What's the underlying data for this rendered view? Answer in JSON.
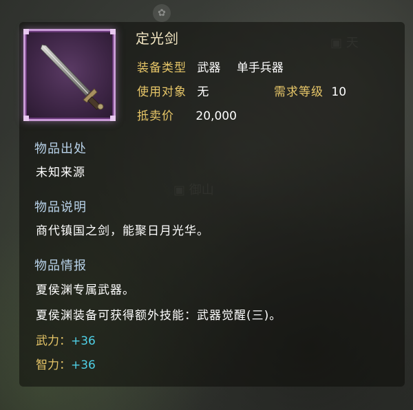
{
  "item": {
    "name": "定光剑",
    "icon": "sword-icon",
    "frame_color": "#c99bd6"
  },
  "attributes": {
    "equip_type_label": "装备类型",
    "equip_type_value": "武器",
    "weapon_class": "单手兵器",
    "user_label": "使用对象",
    "user_value": "无",
    "level_label": "需求等级",
    "level_value": "10",
    "price_label": "抵卖价",
    "price_value": "20,000"
  },
  "origin": {
    "heading": "物品出处",
    "text": "未知来源"
  },
  "description": {
    "heading": "物品说明",
    "text": "商代镇国之剑，能聚日月光华。"
  },
  "info": {
    "heading": "物品情报",
    "lines": [
      "夏侯渊专属武器。",
      "夏侯渊装备可获得额外技能：武器觉醒(三)。"
    ]
  },
  "stats": [
    {
      "label": "武力：",
      "value": "+36"
    },
    {
      "label": "智力：",
      "value": "+36"
    }
  ],
  "colors": {
    "label_gold": "#e7c668",
    "section_blue": "#b9d3ea",
    "bonus_cyan": "#4fd0e6"
  }
}
